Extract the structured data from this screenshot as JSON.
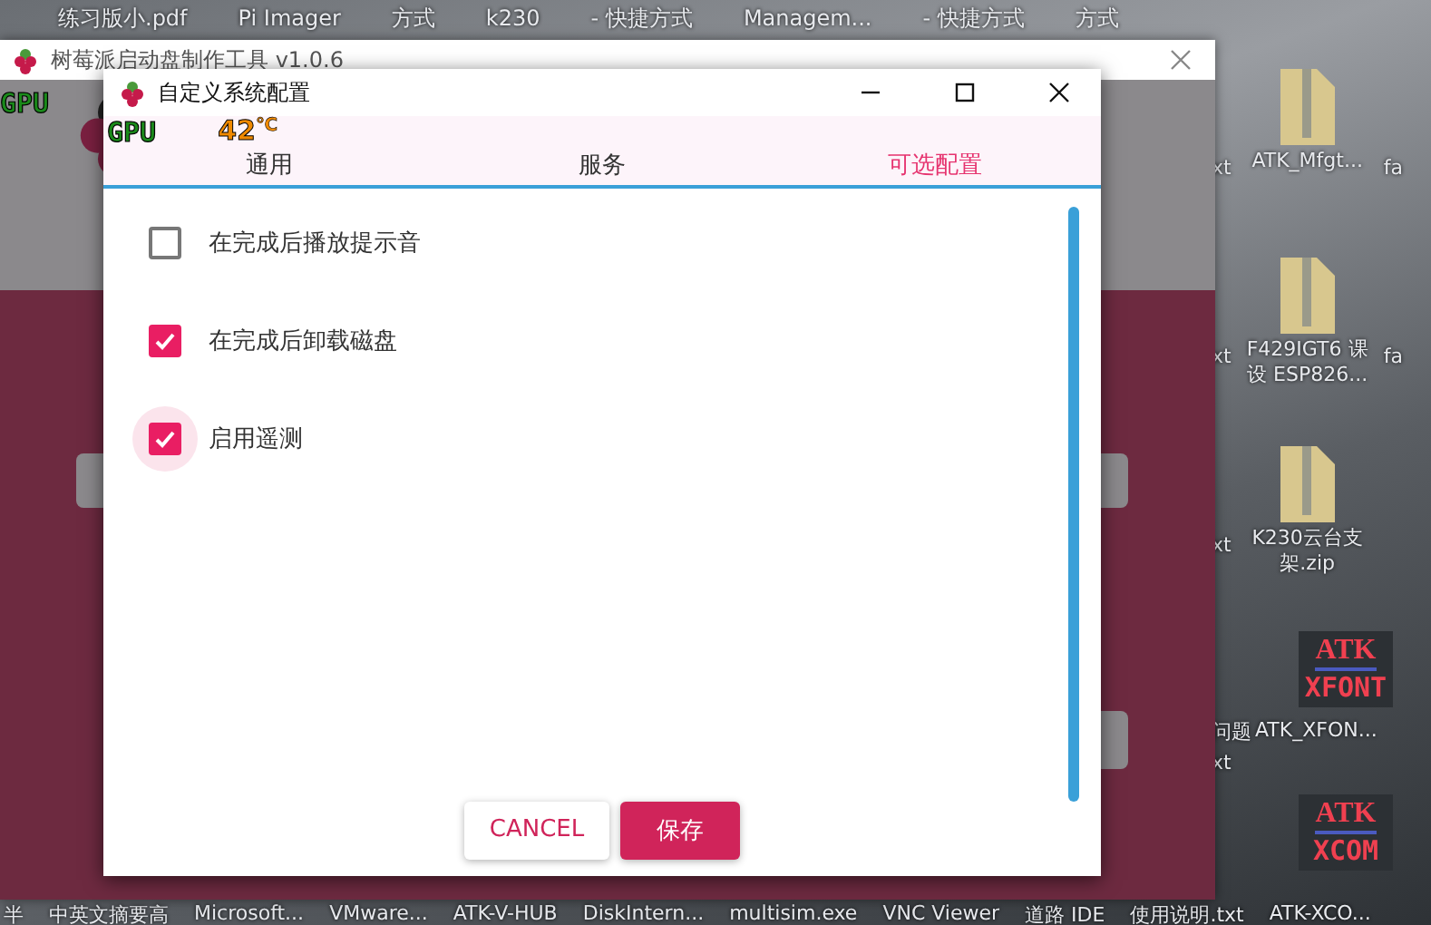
{
  "desktop": {
    "top_labels": [
      "练习版小.pdf",
      "Pi Imager",
      "方式",
      "k230",
      "- 快捷方式",
      "Managem...",
      "- 快捷方式",
      "方式"
    ],
    "right_icon_rows": [
      {
        "items": [
          {
            "kind": "partial",
            "label": "xt"
          },
          {
            "kind": "zip",
            "label": "ATK_Mfgt..."
          },
          {
            "kind": "partial",
            "label": "fa"
          }
        ]
      },
      {
        "items": [
          {
            "kind": "partial",
            "label": "xt"
          },
          {
            "kind": "zip",
            "label": "F429IGT6 课设 ESP826..."
          },
          {
            "kind": "partial",
            "label": "fa"
          }
        ]
      },
      {
        "items": [
          {
            "kind": "partial",
            "label": "xt"
          },
          {
            "kind": "zip",
            "label": "K230云台支架.zip"
          }
        ]
      },
      {
        "items": [
          {
            "kind": "logo",
            "label": "ATK",
            "sub": "XFONT"
          }
        ]
      },
      {
        "items": [
          {
            "kind": "partial",
            "label": "问题"
          },
          {
            "kind": "partial",
            "label": "ATK_XFON..."
          }
        ]
      },
      {
        "items": [
          {
            "kind": "partial",
            "label": "xt"
          }
        ]
      },
      {
        "items": [
          {
            "kind": "logo",
            "label": "ATK",
            "sub": "XCOM"
          }
        ]
      }
    ],
    "bottom_labels": [
      "半",
      "中英文摘要高",
      "Microsoft...",
      "VMware...",
      "ATK-V-HUB",
      "DiskIntern...",
      "multisim.exe",
      "VNC Viewer",
      "道路 IDE",
      "使用说明.txt",
      "ATK-XCO..."
    ]
  },
  "background_window": {
    "title": "树莓派启动盘制作工具 v1.0.6",
    "overlay_label": "GPU"
  },
  "dialog": {
    "title": "自定义系统配置",
    "overlay": {
      "label": "GPU",
      "reading": "42",
      "unit": "℃"
    },
    "tabs": [
      {
        "label": "通用",
        "selected": false
      },
      {
        "label": "服务",
        "selected": false
      },
      {
        "label": "可选配置",
        "selected": true
      }
    ],
    "options": [
      {
        "label": "在完成后播放提示音",
        "checked": false,
        "focused": false
      },
      {
        "label": "在完成后卸载磁盘",
        "checked": true,
        "focused": false
      },
      {
        "label": "启用遥测",
        "checked": true,
        "focused": true
      }
    ],
    "buttons": [
      {
        "label": "CANCEL",
        "kind": "secondary"
      },
      {
        "label": "保存",
        "kind": "primary"
      }
    ]
  }
}
